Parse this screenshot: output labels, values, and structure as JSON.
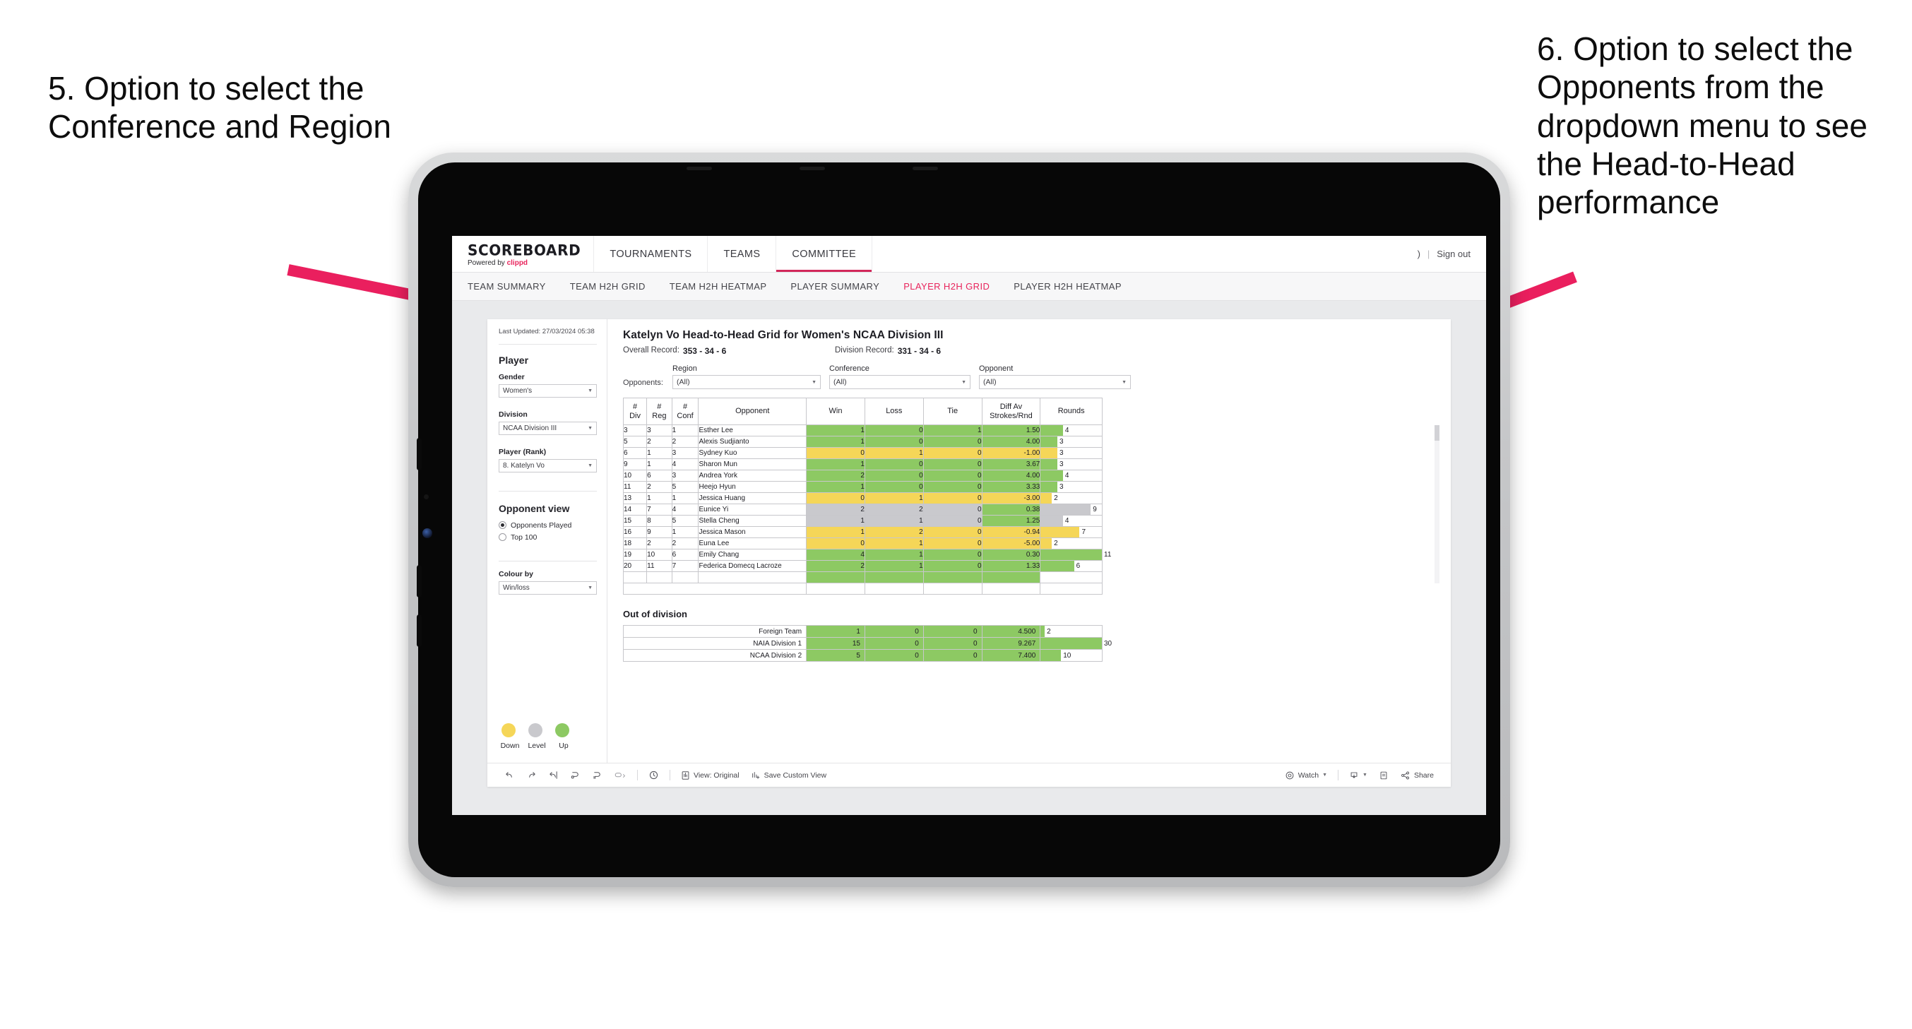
{
  "annotations": {
    "left": "5. Option to select the Conference and Region",
    "right": "6. Option to select the Opponents from the dropdown menu to see the Head-to-Head performance"
  },
  "colors": {
    "accent_pink": "#e8245c",
    "arrow": "#ea1f5e",
    "up_green": "#8dc963",
    "down_yellow": "#f5d658",
    "level_gray": "#c9c9cd"
  },
  "app": {
    "brand": {
      "title": "SCOREBOARD",
      "powered_prefix": "Powered by ",
      "powered_brand": "clippd"
    },
    "main_nav": [
      {
        "label": "TOURNAMENTS",
        "active": false
      },
      {
        "label": "TEAMS",
        "active": false
      },
      {
        "label": "COMMITTEE",
        "active": true
      }
    ],
    "header_right": {
      "user_glyph": ")",
      "separator": "|",
      "sign_out": "Sign out"
    },
    "sub_nav": [
      {
        "label": "TEAM SUMMARY",
        "active": false
      },
      {
        "label": "TEAM H2H GRID",
        "active": false
      },
      {
        "label": "TEAM H2H HEATMAP",
        "active": false
      },
      {
        "label": "PLAYER SUMMARY",
        "active": false
      },
      {
        "label": "PLAYER H2H GRID",
        "active": true
      },
      {
        "label": "PLAYER H2H HEATMAP",
        "active": false
      }
    ]
  },
  "sidebar": {
    "last_updated": "Last Updated: 27/03/2024 05:38",
    "section_player": "Player",
    "gender": {
      "label": "Gender",
      "value": "Women's"
    },
    "division": {
      "label": "Division",
      "value": "NCAA Division III"
    },
    "player_rank": {
      "label": "Player (Rank)",
      "value": "8. Katelyn Vo"
    },
    "opponent_view": {
      "label": "Opponent view",
      "options": [
        {
          "label": "Opponents Played",
          "selected": true
        },
        {
          "label": "Top 100",
          "selected": false
        }
      ]
    },
    "colour_by": {
      "label": "Colour by",
      "value": "Win/loss"
    },
    "legend": [
      {
        "label": "Down",
        "color": "#f5d658"
      },
      {
        "label": "Level",
        "color": "#c9c9cd"
      },
      {
        "label": "Up",
        "color": "#8dc963"
      }
    ]
  },
  "viz": {
    "title": "Katelyn Vo Head-to-Head Grid for Women's NCAA Division III",
    "overall_record": {
      "label": "Overall Record:",
      "value": "353 - 34 - 6"
    },
    "division_record": {
      "label": "Division Record:",
      "value": "331 - 34 - 6"
    },
    "filters_label": "Opponents:",
    "filters": [
      {
        "label": "Region",
        "value": "(All)"
      },
      {
        "label": "Conference",
        "value": "(All)"
      },
      {
        "label": "Opponent",
        "value": "(All)"
      }
    ],
    "out_of_division_title": "Out of division"
  },
  "chart_data": {
    "type": "table",
    "title": "Katelyn Vo Head-to-Head Grid for Women's NCAA Division III",
    "columns": [
      "# Div",
      "# Reg",
      "# Conf",
      "Opponent",
      "Win",
      "Loss",
      "Tie",
      "Diff Av Strokes/Rnd",
      "Rounds"
    ],
    "column_headers_two_line": [
      [
        "#",
        "Div"
      ],
      [
        "#",
        "Reg"
      ],
      [
        "#",
        "Conf"
      ],
      [
        "Opponent",
        ""
      ],
      [
        "Win",
        ""
      ],
      [
        "Loss",
        ""
      ],
      [
        "Tie",
        ""
      ],
      [
        "Diff Av",
        "Strokes/Rnd"
      ],
      [
        "Rounds",
        ""
      ]
    ],
    "rounds_max": 11,
    "rows": [
      {
        "div": "3",
        "reg": "3",
        "conf": "1",
        "opponent": "Esther Lee",
        "win": "1",
        "loss": "0",
        "tie": "1",
        "diff": "1.50",
        "rounds": "4",
        "status": "up"
      },
      {
        "div": "5",
        "reg": "2",
        "conf": "2",
        "opponent": "Alexis Sudjianto",
        "win": "1",
        "loss": "0",
        "tie": "0",
        "diff": "4.00",
        "rounds": "3",
        "status": "up"
      },
      {
        "div": "6",
        "reg": "1",
        "conf": "3",
        "opponent": "Sydney Kuo",
        "win": "0",
        "loss": "1",
        "tie": "0",
        "diff": "-1.00",
        "rounds": "3",
        "status": "down"
      },
      {
        "div": "9",
        "reg": "1",
        "conf": "4",
        "opponent": "Sharon Mun",
        "win": "1",
        "loss": "0",
        "tie": "0",
        "diff": "3.67",
        "rounds": "3",
        "status": "up"
      },
      {
        "div": "10",
        "reg": "6",
        "conf": "3",
        "opponent": "Andrea York",
        "win": "2",
        "loss": "0",
        "tie": "0",
        "diff": "4.00",
        "rounds": "4",
        "status": "up"
      },
      {
        "div": "11",
        "reg": "2",
        "conf": "5",
        "opponent": "Heejo Hyun",
        "win": "1",
        "loss": "0",
        "tie": "0",
        "diff": "3.33",
        "rounds": "3",
        "status": "up"
      },
      {
        "div": "13",
        "reg": "1",
        "conf": "1",
        "opponent": "Jessica Huang",
        "win": "0",
        "loss": "1",
        "tie": "0",
        "diff": "-3.00",
        "rounds": "2",
        "status": "down"
      },
      {
        "div": "14",
        "reg": "7",
        "conf": "4",
        "opponent": "Eunice Yi",
        "win": "2",
        "loss": "2",
        "tie": "0",
        "diff": "0.38",
        "rounds": "9",
        "status": "level",
        "diff_status": "up"
      },
      {
        "div": "15",
        "reg": "8",
        "conf": "5",
        "opponent": "Stella Cheng",
        "win": "1",
        "loss": "1",
        "tie": "0",
        "diff": "1.25",
        "rounds": "4",
        "status": "level",
        "diff_status": "up"
      },
      {
        "div": "16",
        "reg": "9",
        "conf": "1",
        "opponent": "Jessica Mason",
        "win": "1",
        "loss": "2",
        "tie": "0",
        "diff": "-0.94",
        "rounds": "7",
        "status": "down"
      },
      {
        "div": "18",
        "reg": "2",
        "conf": "2",
        "opponent": "Euna Lee",
        "win": "0",
        "loss": "1",
        "tie": "0",
        "diff": "-5.00",
        "rounds": "2",
        "status": "down"
      },
      {
        "div": "19",
        "reg": "10",
        "conf": "6",
        "opponent": "Emily Chang",
        "win": "4",
        "loss": "1",
        "tie": "0",
        "diff": "0.30",
        "rounds": "11",
        "status": "up"
      },
      {
        "div": "20",
        "reg": "11",
        "conf": "7",
        "opponent": "Federica Domecq Lacroze",
        "win": "2",
        "loss": "1",
        "tie": "0",
        "diff": "1.33",
        "rounds": "6",
        "status": "up"
      }
    ],
    "out_of_division": {
      "rounds_max": 30,
      "rows": [
        {
          "name": "Foreign Team",
          "win": "1",
          "loss": "0",
          "tie": "0",
          "diff": "4.500",
          "rounds": "2",
          "status": "up"
        },
        {
          "name": "NAIA Division 1",
          "win": "15",
          "loss": "0",
          "tie": "0",
          "diff": "9.267",
          "rounds": "30",
          "status": "up"
        },
        {
          "name": "NCAA Division 2",
          "win": "5",
          "loss": "0",
          "tie": "0",
          "diff": "7.400",
          "rounds": "10",
          "status": "up"
        }
      ]
    }
  },
  "toolbar": {
    "items": [
      {
        "name": "undo",
        "label": ""
      },
      {
        "name": "redo",
        "label": ""
      },
      {
        "name": "revert",
        "label": ""
      },
      {
        "name": "refresh",
        "label": ""
      },
      {
        "name": "pause",
        "label": ""
      },
      {
        "name": "edit",
        "label": ""
      }
    ],
    "view_original": "View: Original",
    "save_custom_view": "Save Custom View",
    "watch": "Watch",
    "share": "Share"
  }
}
